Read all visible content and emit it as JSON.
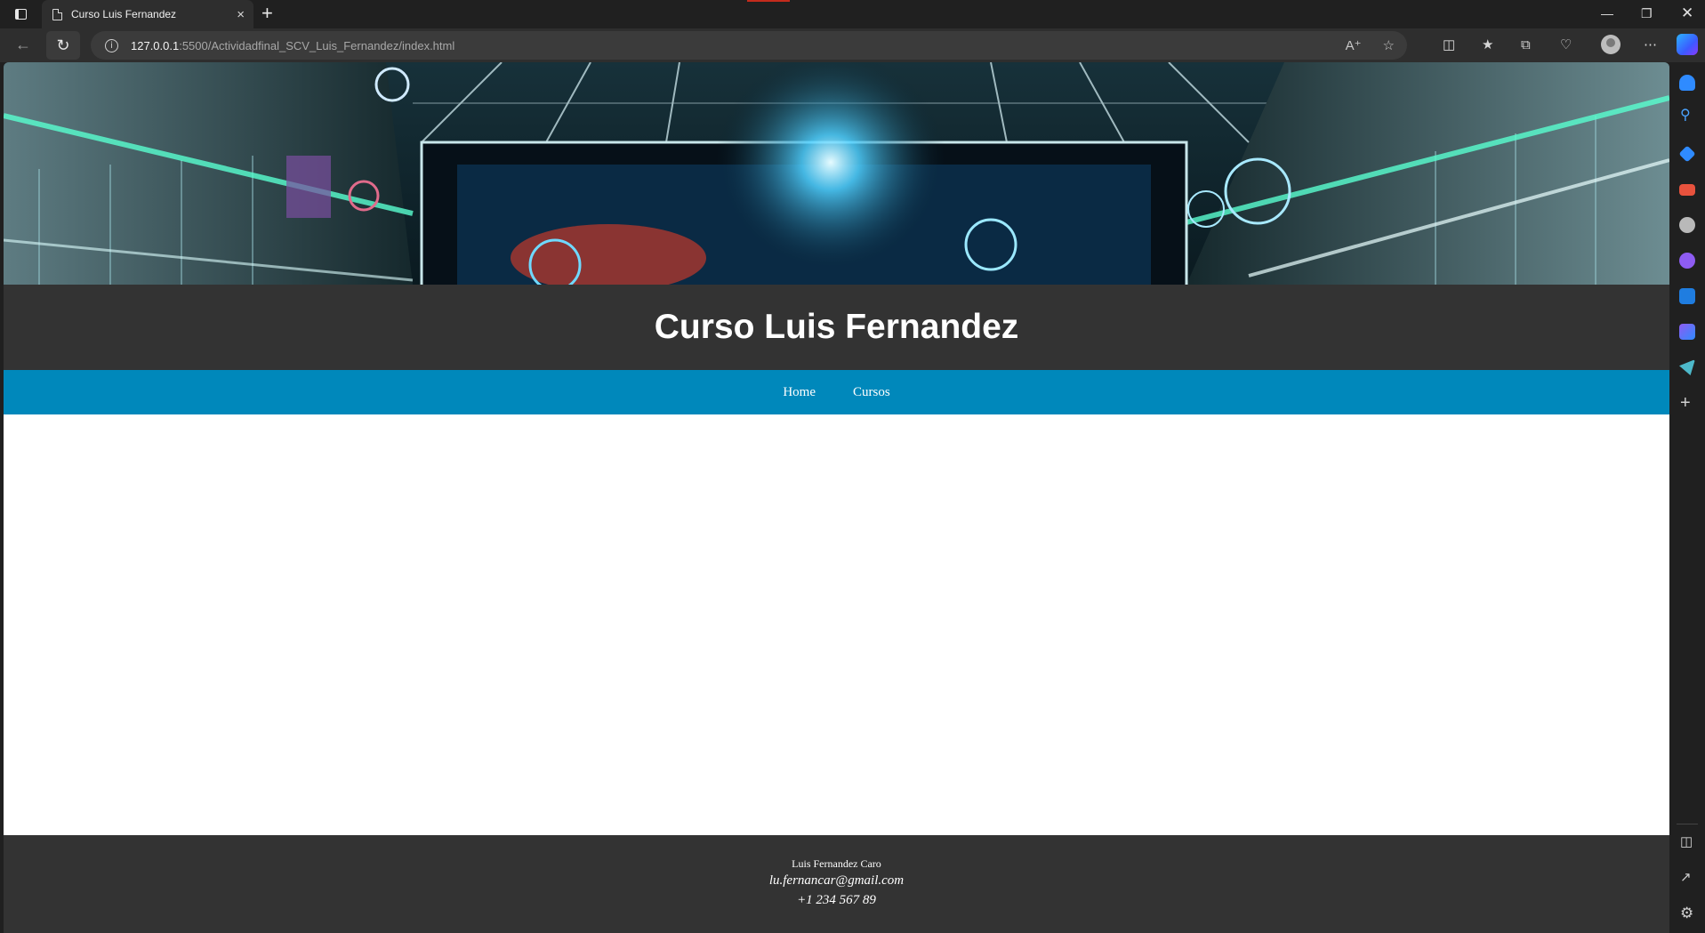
{
  "browser": {
    "tab_title": "Curso Luis Fernandez",
    "tab_close": "×",
    "new_tab": "+",
    "url_host": "127.0.0.1",
    "url_path": ":5500/Actividadfinal_SCV_Luis_Fernandez/index.html",
    "icons": [
      "tab-actions-icon",
      "page-icon",
      "close-icon",
      "new-tab-icon",
      "back-icon",
      "reload-icon",
      "site-info-icon",
      "read-aloud-icon",
      "favorite-star-icon",
      "split-screen-icon",
      "favorites-icon",
      "collections-icon",
      "browser-essentials-icon",
      "profile-avatar",
      "more-menu-icon",
      "copilot-icon",
      "minimize-icon",
      "restore-icon",
      "window-close-icon"
    ]
  },
  "sidebar": {
    "icons": [
      "notification-icon",
      "search-icon",
      "shopping-tag-icon",
      "tools-briefcase-icon",
      "games-icon",
      "bing-icon",
      "outlook-icon",
      "designer-icon",
      "telegram-icon",
      "add-icon",
      "split-panel-icon",
      "external-link-icon",
      "settings-icon"
    ],
    "colors": {
      "blue": "#2f8bff",
      "red": "#e8523d",
      "purple": "#8e5cf2",
      "teal": "#4db8c9",
      "gray": "#b9b9b9"
    }
  },
  "site": {
    "title": "Curso Luis Fernandez",
    "nav": [
      {
        "label": "Home"
      },
      {
        "label": "Cursos"
      }
    ],
    "footer": {
      "name": "Luis Fernandez Caro",
      "email": "lu.fernancar@gmail.com",
      "phone": "+1 234 567 89"
    },
    "colors": {
      "header_bg": "#333333",
      "nav_bg": "#0088bb",
      "content_bg": "#ffffff",
      "footer_bg": "#333333"
    }
  }
}
